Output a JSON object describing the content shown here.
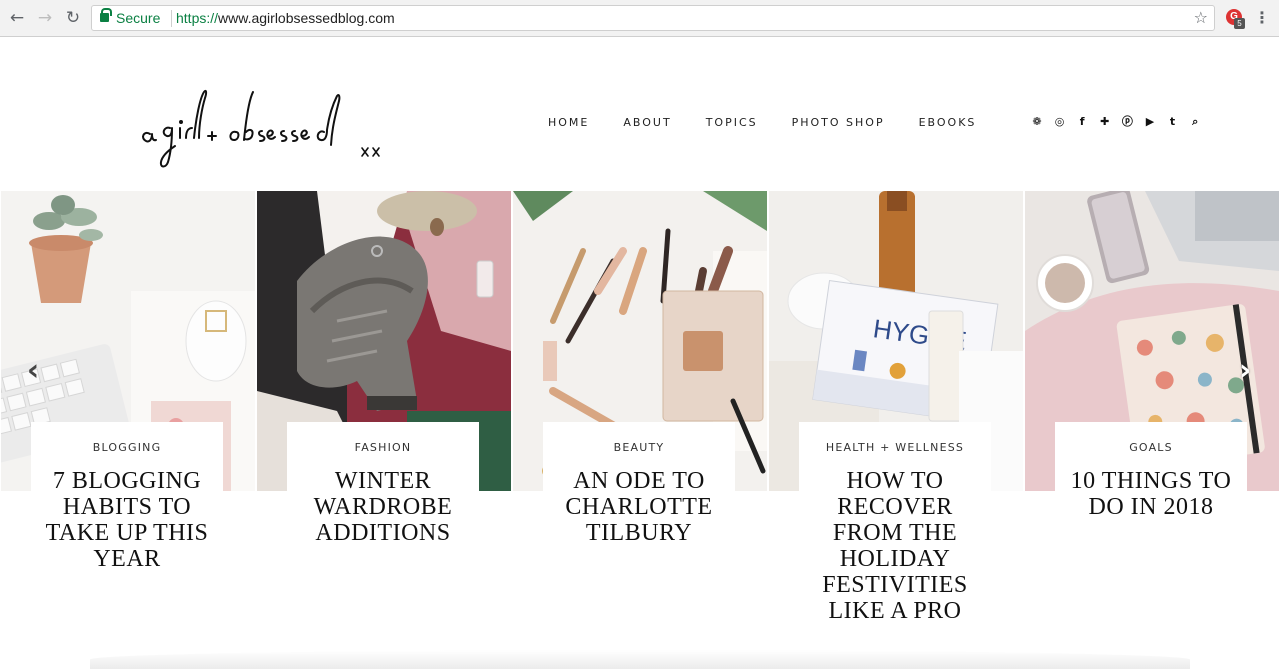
{
  "browser": {
    "back_icon": "←",
    "forward_icon": "→",
    "reload_icon": "↻",
    "secure_label": "Secure",
    "url_scheme": "https://",
    "url_host": "www.agirlobsessedblog.com",
    "bookmark_icon": "☆",
    "extension_badge": "5",
    "menu_icon": "⋮"
  },
  "site": {
    "logo_text": "a girl obsessed",
    "logo_suffix": "xx",
    "nav": [
      "HOME",
      "ABOUT",
      "TOPICS",
      "PHOTO SHOP",
      "EBOOKS"
    ],
    "social_icons": [
      "twitter-icon",
      "instagram-icon",
      "facebook-icon",
      "bloglovin-icon",
      "pinterest-icon",
      "youtube-icon",
      "tumblr-icon",
      "search-icon"
    ],
    "social_glyphs": [
      "❁",
      "◎",
      "f",
      "✚",
      "ⓟ",
      "▶",
      "t",
      "⌕"
    ]
  },
  "slider": {
    "prev_icon": "‹",
    "next_icon": "›",
    "slides": [
      {
        "category": "BLOGGING",
        "title": "7 BLOGGING HABITS TO TAKE UP THIS YEAR"
      },
      {
        "category": "FASHION",
        "title": "WINTER WARDROBE ADDITIONS"
      },
      {
        "category": "BEAUTY",
        "title": "AN ODE TO CHARLOTTE TILBURY"
      },
      {
        "category": "HEALTH + WELLNESS",
        "title": "HOW TO RECOVER FROM THE HOLIDAY FESTIVITIES LIKE A PRO"
      },
      {
        "category": "GOALS",
        "title": "10 THINGS TO DO IN 2018"
      }
    ]
  },
  "colors": {
    "secure_green": "#0b8043",
    "text_dark": "#111111"
  }
}
